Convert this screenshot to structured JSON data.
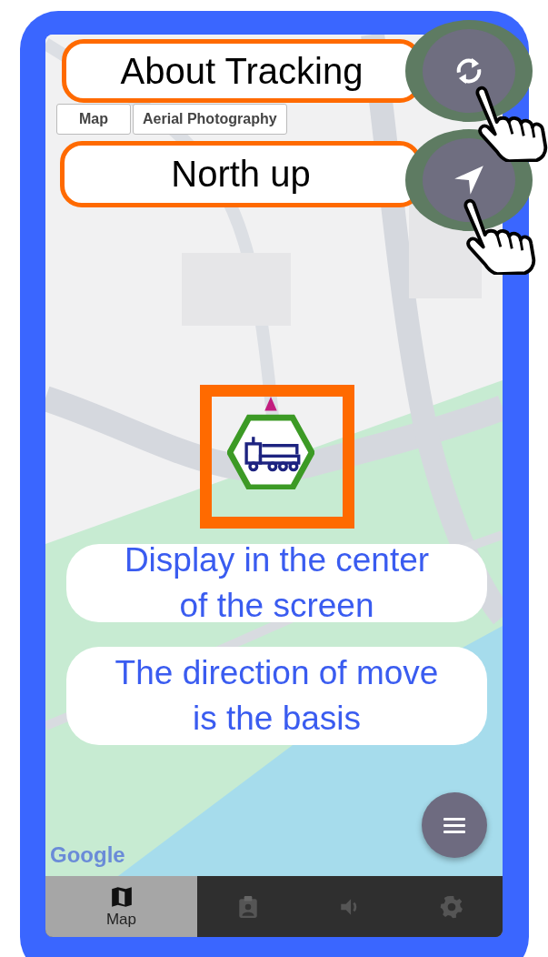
{
  "callouts": [
    {
      "text": "About Tracking",
      "kind": "outlined"
    },
    {
      "text": "North up",
      "kind": "outlined"
    },
    {
      "text": "Display in the center of the screen",
      "kind": "plain"
    },
    {
      "text": "The direction of move is the basis",
      "kind": "plain"
    }
  ],
  "map_type_buttons": [
    {
      "label": "Map"
    },
    {
      "label": "Aerial Photography"
    }
  ],
  "map": {
    "kind": "picture",
    "attribution": "Google"
  },
  "bottom_nav": [
    {
      "kind": "map",
      "label": "Map",
      "selected": true
    },
    {
      "kind": "report",
      "selected": false
    },
    {
      "kind": "sound",
      "selected": false
    },
    {
      "kind": "settings",
      "selected": false
    }
  ]
}
